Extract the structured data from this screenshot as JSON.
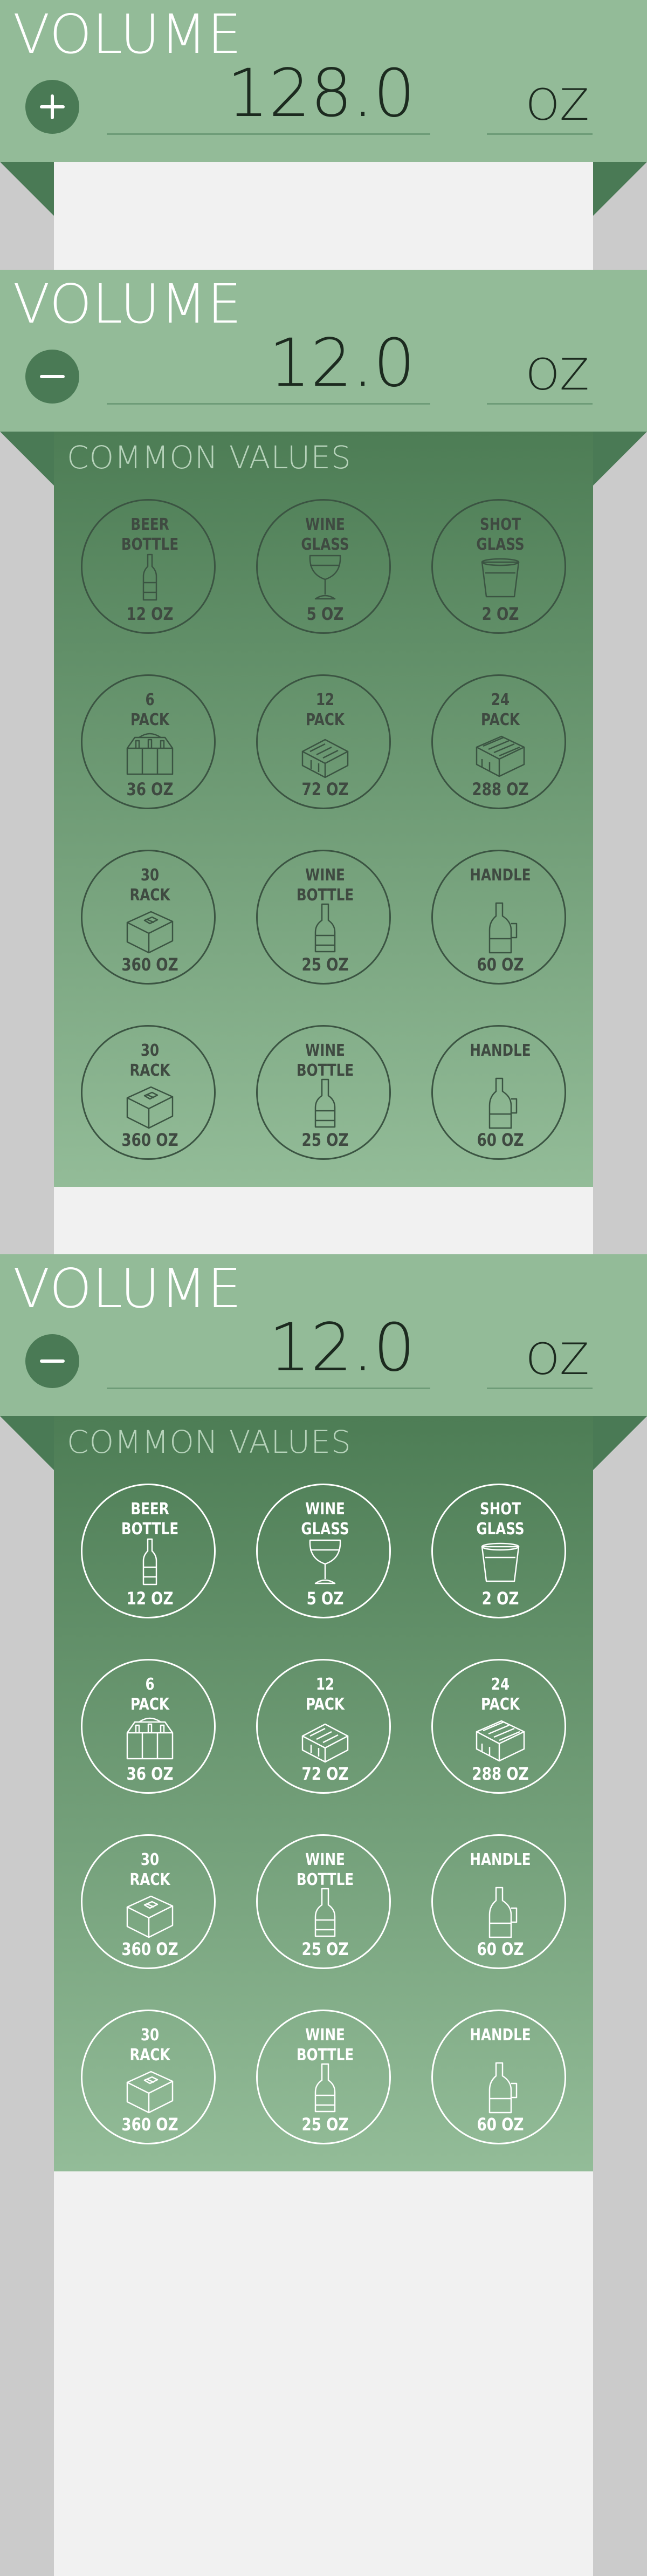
{
  "app": {
    "colors": {
      "header_bg": "#93bb98",
      "panel_top": "#4d7d55",
      "panel_bottom": "#93bc98",
      "button_bg": "#4a7a55",
      "content_bg": "#f1f1f1",
      "side_bg": "#cbcbcb",
      "dark_line": "#3b5442",
      "light_line": "#ffffff"
    }
  },
  "screens": [
    {
      "title": "VOLUME",
      "toggle_icon": "plus-icon",
      "value": "128.0",
      "unit": "OZ",
      "panel_open": false
    },
    {
      "title": "VOLUME",
      "toggle_icon": "minus-icon",
      "value": "12.0",
      "unit": "OZ",
      "panel_open": true,
      "panel_title": "COMMON VALUES",
      "line_style": "dark"
    },
    {
      "title": "VOLUME",
      "toggle_icon": "minus-icon",
      "value": "12.0",
      "unit": "OZ",
      "panel_open": true,
      "panel_title": "COMMON VALUES",
      "line_style": "light"
    }
  ],
  "common_values": [
    {
      "label": "BEER\nBOTTLE",
      "amount": "12 OZ",
      "icon": "beer-bottle-icon"
    },
    {
      "label": "WINE\nGLASS",
      "amount": "5 OZ",
      "icon": "wine-glass-icon"
    },
    {
      "label": "SHOT\nGLASS",
      "amount": "2 OZ",
      "icon": "shot-glass-icon"
    },
    {
      "label": "6\nPACK",
      "amount": "36 OZ",
      "icon": "six-pack-icon"
    },
    {
      "label": "12\nPACK",
      "amount": "72 OZ",
      "icon": "twelve-pack-icon"
    },
    {
      "label": "24\nPACK",
      "amount": "288 OZ",
      "icon": "twenty-four-pack-icon"
    },
    {
      "label": "30\nRACK",
      "amount": "360 OZ",
      "icon": "thirty-rack-icon"
    },
    {
      "label": "WINE\nBOTTLE",
      "amount": "25 OZ",
      "icon": "wine-bottle-icon"
    },
    {
      "label": "HANDLE",
      "amount": "60 OZ",
      "icon": "handle-icon"
    },
    {
      "label": "30\nRACK",
      "amount": "360 OZ",
      "icon": "thirty-rack-icon"
    },
    {
      "label": "WINE\nBOTTLE",
      "amount": "25 OZ",
      "icon": "wine-bottle-icon"
    },
    {
      "label": "HANDLE",
      "amount": "60 OZ",
      "icon": "handle-icon"
    }
  ]
}
